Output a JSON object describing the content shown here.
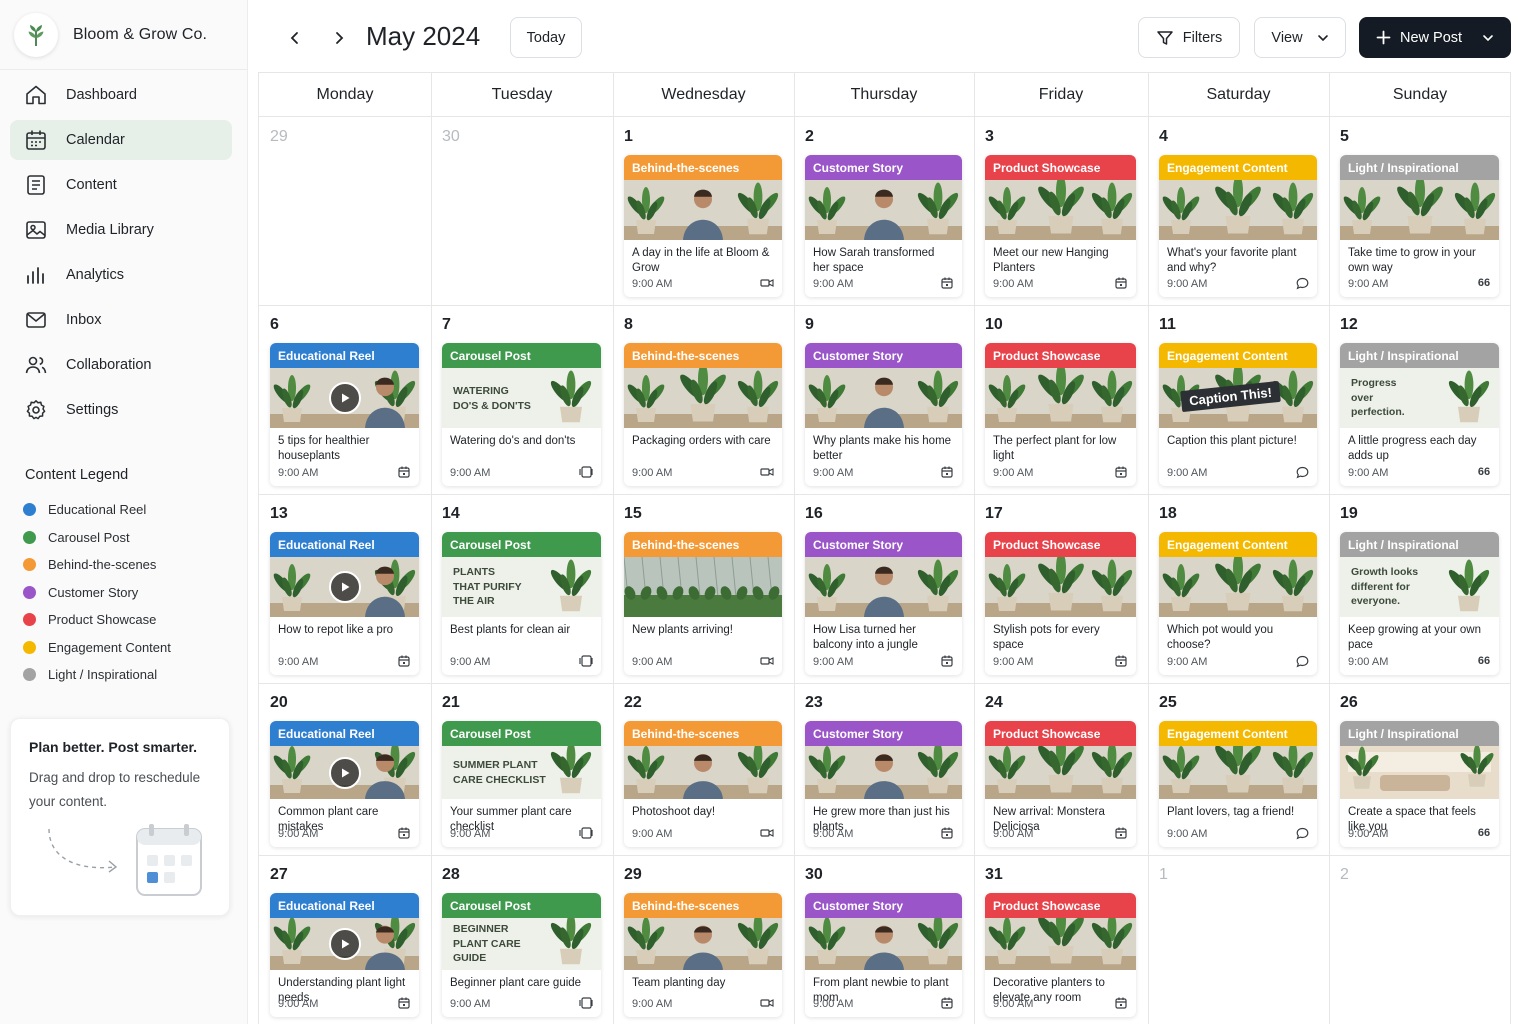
{
  "brand": {
    "name": "Bloom & Grow Co."
  },
  "nav": [
    {
      "label": "Dashboard",
      "icon": "home-icon",
      "active": false
    },
    {
      "label": "Calendar",
      "icon": "calendar-icon",
      "active": true
    },
    {
      "label": "Content",
      "icon": "document-icon",
      "active": false
    },
    {
      "label": "Media Library",
      "icon": "image-icon",
      "active": false
    },
    {
      "label": "Analytics",
      "icon": "bar-chart-icon",
      "active": false
    },
    {
      "label": "Inbox",
      "icon": "mail-icon",
      "active": false
    },
    {
      "label": "Collaboration",
      "icon": "users-icon",
      "active": false
    },
    {
      "label": "Settings",
      "icon": "gear-icon",
      "active": false
    }
  ],
  "legend": {
    "title": "Content Legend",
    "items": [
      {
        "label": "Educational Reel",
        "color": "#2f7fd1"
      },
      {
        "label": "Carousel Post",
        "color": "#3f9a4e"
      },
      {
        "label": "Behind-the-scenes",
        "color": "#f39a36"
      },
      {
        "label": "Customer Story",
        "color": "#9a55c9"
      },
      {
        "label": "Product Showcase",
        "color": "#e8424a"
      },
      {
        "label": "Engagement Content",
        "color": "#f5b800"
      },
      {
        "label": "Light / Inspirational",
        "color": "#a3a3a3"
      }
    ]
  },
  "promo": {
    "title": "Plan better. Post smarter.",
    "text": "Drag and drop to reschedule your content."
  },
  "header": {
    "month": "May 2024",
    "today": "Today",
    "filters": "Filters",
    "view": "View",
    "new_post": "New Post"
  },
  "weekdays": [
    "Monday",
    "Tuesday",
    "Wednesday",
    "Thursday",
    "Friday",
    "Saturday",
    "Sunday"
  ],
  "categories": {
    "edu": {
      "label": "Educational Reel",
      "color": "#2f7fd1",
      "icon": "calendar-small-icon"
    },
    "car": {
      "label": "Carousel Post",
      "color": "#3f9a4e",
      "icon": "carousel-icon"
    },
    "bts": {
      "label": "Behind-the-scenes",
      "color": "#f39a36",
      "icon": "video-icon"
    },
    "cust": {
      "label": "Customer Story",
      "color": "#9a55c9",
      "icon": "calendar-small-icon"
    },
    "prod": {
      "label": "Product Showcase",
      "color": "#e8424a",
      "icon": "calendar-small-icon"
    },
    "eng": {
      "label": "Engagement Content",
      "color": "#f5b800",
      "icon": "comment-icon"
    },
    "insp": {
      "label": "Light / Inspirational",
      "color": "#a3a3a3",
      "icon": "quote-icon"
    }
  },
  "quote_glyph": "66",
  "weeks": [
    [
      {
        "day": "29",
        "muted": true
      },
      {
        "day": "30",
        "muted": true
      },
      {
        "day": "1",
        "post": {
          "cat": "bts",
          "title": "A day in the life at Bloom & Grow",
          "time": "9:00 AM",
          "art": "person"
        }
      },
      {
        "day": "2",
        "post": {
          "cat": "cust",
          "title": "How Sarah transformed her space",
          "time": "9:00 AM",
          "art": "person"
        }
      },
      {
        "day": "3",
        "post": {
          "cat": "prod",
          "title": "Meet our new Hanging Planters",
          "time": "9:00 AM",
          "art": "plants"
        }
      },
      {
        "day": "4",
        "post": {
          "cat": "eng",
          "title": "What's your favorite plant and why?",
          "time": "9:00 AM",
          "art": "plants"
        }
      },
      {
        "day": "5",
        "post": {
          "cat": "insp",
          "title": "Take time to grow in your own way",
          "time": "9:00 AM",
          "art": "plants"
        }
      }
    ],
    [
      {
        "day": "6",
        "post": {
          "cat": "edu",
          "title": "5 tips for healthier houseplants",
          "time": "9:00 AM",
          "art": "play"
        }
      },
      {
        "day": "7",
        "post": {
          "cat": "car",
          "title": "Watering do's and don'ts",
          "time": "9:00 AM",
          "art": "text",
          "overlay": "WATERING\nDO'S & DON'TS"
        }
      },
      {
        "day": "8",
        "post": {
          "cat": "bts",
          "title": "Packaging orders with care",
          "time": "9:00 AM",
          "art": "plants"
        }
      },
      {
        "day": "9",
        "post": {
          "cat": "cust",
          "title": "Why plants make his home better",
          "time": "9:00 AM",
          "art": "person"
        }
      },
      {
        "day": "10",
        "post": {
          "cat": "prod",
          "title": "The perfect plant for low light",
          "time": "9:00 AM",
          "art": "plants"
        }
      },
      {
        "day": "11",
        "post": {
          "cat": "eng",
          "title": "Caption this plant picture!",
          "time": "9:00 AM",
          "art": "caption",
          "overlay": "Caption This!"
        }
      },
      {
        "day": "12",
        "post": {
          "cat": "insp",
          "title": "A little progress each day adds up",
          "time": "9:00 AM",
          "art": "text",
          "overlay": "Progress\nover\nperfection."
        }
      }
    ],
    [
      {
        "day": "13",
        "post": {
          "cat": "edu",
          "title": "How to repot like a pro",
          "time": "9:00 AM",
          "art": "play"
        }
      },
      {
        "day": "14",
        "post": {
          "cat": "car",
          "title": "Best plants for clean air",
          "time": "9:00 AM",
          "art": "text",
          "overlay": "PLANTS\nTHAT PURIFY\nTHE AIR"
        }
      },
      {
        "day": "15",
        "post": {
          "cat": "bts",
          "title": "New plants arriving!",
          "time": "9:00 AM",
          "art": "greenhouse"
        }
      },
      {
        "day": "16",
        "post": {
          "cat": "cust",
          "title": "How Lisa turned her balcony into a jungle",
          "time": "9:00 AM",
          "art": "person"
        }
      },
      {
        "day": "17",
        "post": {
          "cat": "prod",
          "title": "Stylish pots for every space",
          "time": "9:00 AM",
          "art": "plants"
        }
      },
      {
        "day": "18",
        "post": {
          "cat": "eng",
          "title": "Which pot would you choose?",
          "time": "9:00 AM",
          "art": "plants"
        }
      },
      {
        "day": "19",
        "post": {
          "cat": "insp",
          "title": "Keep growing at your own pace",
          "time": "9:00 AM",
          "art": "text",
          "overlay": "Growth looks\ndifferent for\neveryone."
        }
      }
    ],
    [
      {
        "day": "20",
        "post": {
          "cat": "edu",
          "title": "Common plant care mistakes",
          "time": "9:00 AM",
          "art": "play"
        }
      },
      {
        "day": "21",
        "post": {
          "cat": "car",
          "title": "Your summer plant care checklist",
          "time": "9:00 AM",
          "art": "text",
          "overlay": "SUMMER PLANT\nCARE CHECKLIST"
        }
      },
      {
        "day": "22",
        "post": {
          "cat": "bts",
          "title": "Photoshoot day!",
          "time": "9:00 AM",
          "art": "person"
        }
      },
      {
        "day": "23",
        "post": {
          "cat": "cust",
          "title": "He grew more than just his plants",
          "time": "9:00 AM",
          "art": "person"
        }
      },
      {
        "day": "24",
        "post": {
          "cat": "prod",
          "title": "New arrival: Monstera Deliciosa",
          "time": "9:00 AM",
          "art": "plants"
        }
      },
      {
        "day": "25",
        "post": {
          "cat": "eng",
          "title": "Plant lovers, tag a friend!",
          "time": "9:00 AM",
          "art": "plants"
        }
      },
      {
        "day": "26",
        "post": {
          "cat": "insp",
          "title": "Create a space that feels like you",
          "time": "9:00 AM",
          "art": "room"
        }
      }
    ],
    [
      {
        "day": "27",
        "post": {
          "cat": "edu",
          "title": "Understanding plant light needs",
          "time": "9:00 AM",
          "art": "play"
        }
      },
      {
        "day": "28",
        "post": {
          "cat": "car",
          "title": "Beginner plant care guide",
          "time": "9:00 AM",
          "art": "text",
          "overlay": "BEGINNER\nPLANT CARE\nGUIDE"
        }
      },
      {
        "day": "29",
        "post": {
          "cat": "bts",
          "title": "Team planting day",
          "time": "9:00 AM",
          "art": "person"
        }
      },
      {
        "day": "30",
        "post": {
          "cat": "cust",
          "title": "From plant newbie to plant mom",
          "time": "9:00 AM",
          "art": "person"
        }
      },
      {
        "day": "31",
        "post": {
          "cat": "prod",
          "title": "Decorative planters to elevate any room",
          "time": "9:00 AM",
          "art": "plants"
        }
      },
      {
        "day": "1",
        "muted": true
      },
      {
        "day": "2",
        "muted": true
      }
    ]
  ]
}
